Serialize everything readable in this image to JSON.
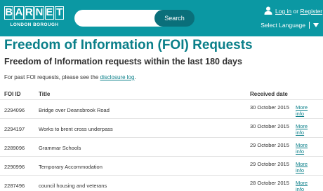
{
  "header": {
    "logo": {
      "word": [
        "B",
        "A",
        "R",
        "N",
        "E",
        "T"
      ],
      "subtitle": "LONDON BOROUGH"
    },
    "search": {
      "placeholder": "",
      "button_label": "Search"
    },
    "auth": {
      "login": "Log in",
      "or": "or",
      "register": "Register"
    },
    "language": {
      "label": "Select Language"
    },
    "colors": {
      "brand": "#0b98a3",
      "search_button": "#0a6f7a",
      "title": "#0a7f89"
    },
    "icons": {
      "user": "user-icon",
      "language_caret": "caret-down-icon"
    }
  },
  "main": {
    "title": "Freedom of Information (FOI) Requests",
    "subtitle": "Freedom of Information requests within the last 180 days",
    "past_note": {
      "text": "For past FOI requests, please see the",
      "link": "disclosure log",
      "end": "."
    },
    "table": {
      "headers": {
        "id": "FOI ID",
        "title": "Title",
        "received": "Received date"
      },
      "more_label": "More info",
      "rows": [
        {
          "id": "2294096",
          "title": "Bridge over Deansbrook Road",
          "date": "30 October 2015"
        },
        {
          "id": "2294197",
          "title": "Works to brent cross underpass",
          "date": "30 October 2015"
        },
        {
          "id": "2289096",
          "title": "Grammar Schools",
          "date": "29 October 2015"
        },
        {
          "id": "2290996",
          "title": "Temporary Accommodation",
          "date": "29 October 2015"
        },
        {
          "id": "2287496",
          "title": "council housing and veterans",
          "date": "28 October 2015"
        }
      ]
    }
  }
}
